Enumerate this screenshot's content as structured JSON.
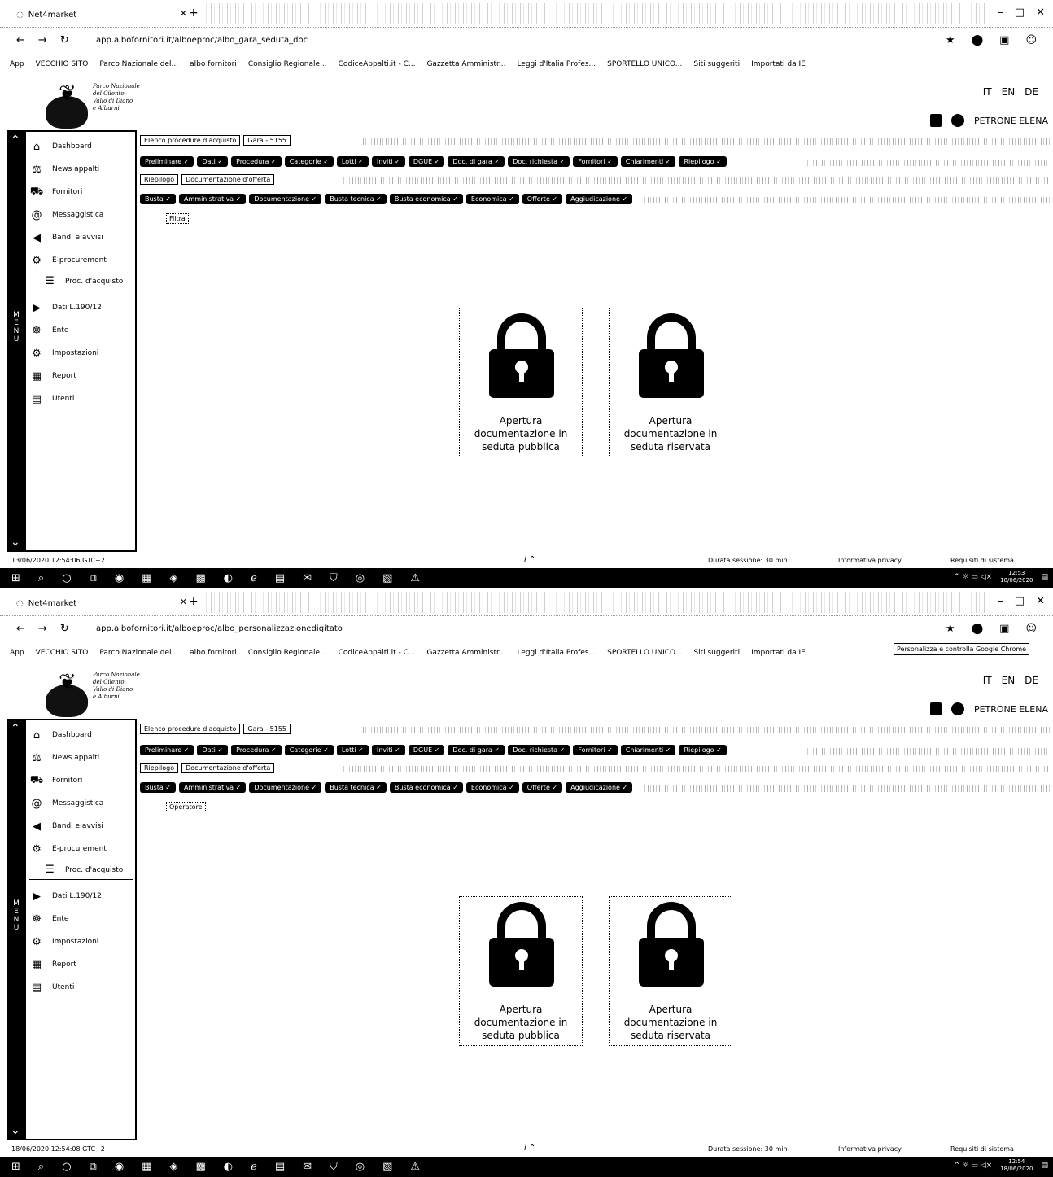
{
  "screens": [
    {
      "tab_title": "Net4market",
      "url": "app.albofornitori.it/alboeproc/albo_gara_seduta_doc",
      "tooltip": "",
      "gara_tab": "Gara - 5155",
      "sub_tab": "Documentazione d'offerta",
      "third_row_label": "Filtra",
      "timestamp": "13/06/2020 12:54:06 GTC+2",
      "clock_time": "12:53",
      "clock_date": "18/06/2020"
    },
    {
      "tab_title": "Net4market",
      "url": "app.albofornitori.it/alboeproc/albo_personalizzazionedigitato",
      "tooltip": "Personalizza e controlla Google Chrome",
      "gara_tab": "Gara - 5155",
      "sub_tab": "Documentazione d'offerta",
      "third_row_label": "Operatore",
      "timestamp": "18/06/2020 12:54:08 GTC+2",
      "clock_time": "12:54",
      "clock_date": "18/06/2020"
    }
  ],
  "bookmarks": [
    "App",
    "VECCHIO SITO",
    "Parco Nazionale del...",
    "albo fornitori",
    "Consiglio Regionale...",
    "CodiceAppalti.it - C...",
    "Gazzetta Amministr...",
    "Leggi d'Italia Profes...",
    "SPORTELLO UNICO...",
    "Siti suggeriti",
    "Importati da IE"
  ],
  "logo_text": [
    "Parco Nazionale",
    "del Cilento",
    "Vallo di Diano",
    "e Alburni"
  ],
  "user_name": "PETRONE ELENA",
  "sidebar": {
    "items": [
      "Dashboard",
      "News appalti",
      "Fornitori",
      "Messaggistica",
      "Bandi e avvisi",
      "E-procurement"
    ],
    "sub_item": "Proc. d'acquisto",
    "items2": [
      "Dati L.190/12",
      "Ente",
      "Impostazioni",
      "Report",
      "Utenti"
    ],
    "menu_label": "MENU"
  },
  "breadcrumb": "Elenco procedure d'acquisto",
  "tab_row1": [
    "Preliminare",
    "Dati",
    "Procedura",
    "Categorie",
    "Lotti",
    "Inviti",
    "DGUE",
    "Doc. di gara",
    "Doc. richiesta",
    "Fornitori",
    "Chiarimenti",
    "Riepilogo"
  ],
  "sub_row_left": "Riepilogo",
  "tab_row2": [
    "Busta",
    "Amministrativa",
    "Documentazione",
    "Busta tecnica",
    "Busta economica",
    "Economica",
    "Offerte",
    "Aggiudicazione"
  ],
  "cards": [
    {
      "label": "Apertura documentazione in seduta pubblica"
    },
    {
      "label": "Apertura documentazione in seduta riservata"
    }
  ],
  "status": {
    "duration": "Durata sessione: 30 min",
    "privacy": "Informativa privacy",
    "requirements": "Requisiti di sistema"
  },
  "langs": [
    "IT",
    "EN",
    "DE"
  ]
}
